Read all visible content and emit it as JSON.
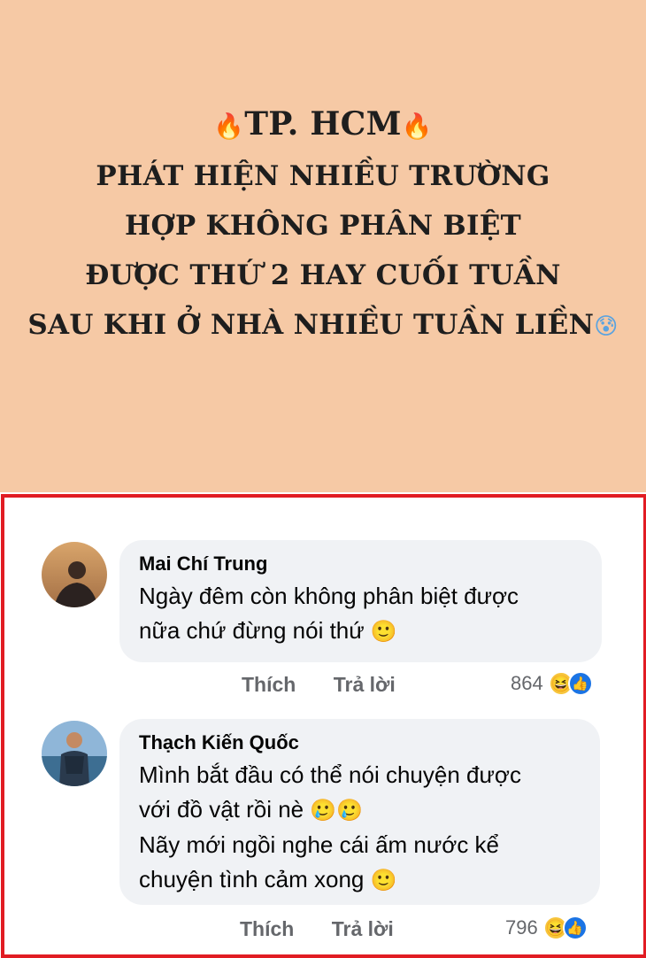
{
  "banner": {
    "line1_text": "TP. HCM",
    "line2": "PHÁT HIỆN NHIỀU TRƯỜNG",
    "line3": "HỢP KHÔNG PHÂN BIỆT",
    "line4": "ĐƯỢC THỨ 2 HAY CUỐI TUẦN",
    "line5": "SAU KHI Ở NHÀ NHIỀU TUẦN LIỀN",
    "fire_emoji": "🔥",
    "fear_emoji": "😰",
    "background": "#f6c9a5"
  },
  "frame_color": "#e11c23",
  "comments": [
    {
      "author": "Mai Chí Trung",
      "line1": "Ngày đêm còn không phân biệt được",
      "line2": "nữa chứ đừng nói thứ",
      "emoji": "🙂",
      "like_label": "Thích",
      "reply_label": "Trả lời",
      "reaction_count": "864"
    },
    {
      "author": "Thạch Kiến Quốc",
      "line1": "Mình bắt đầu có thể nói chuyện được",
      "line2": "với đồ vật rồi nè",
      "line2_emoji": "🥲🥲",
      "line3": "Nãy mới ngồi nghe cái ấm nước kể",
      "line4": "chuyện tình cảm xong",
      "emoji": "🙂",
      "like_label": "Thích",
      "reply_label": "Trả lời",
      "reaction_count": "796"
    }
  ],
  "reaction_icons": [
    "haha-icon",
    "like-icon"
  ]
}
